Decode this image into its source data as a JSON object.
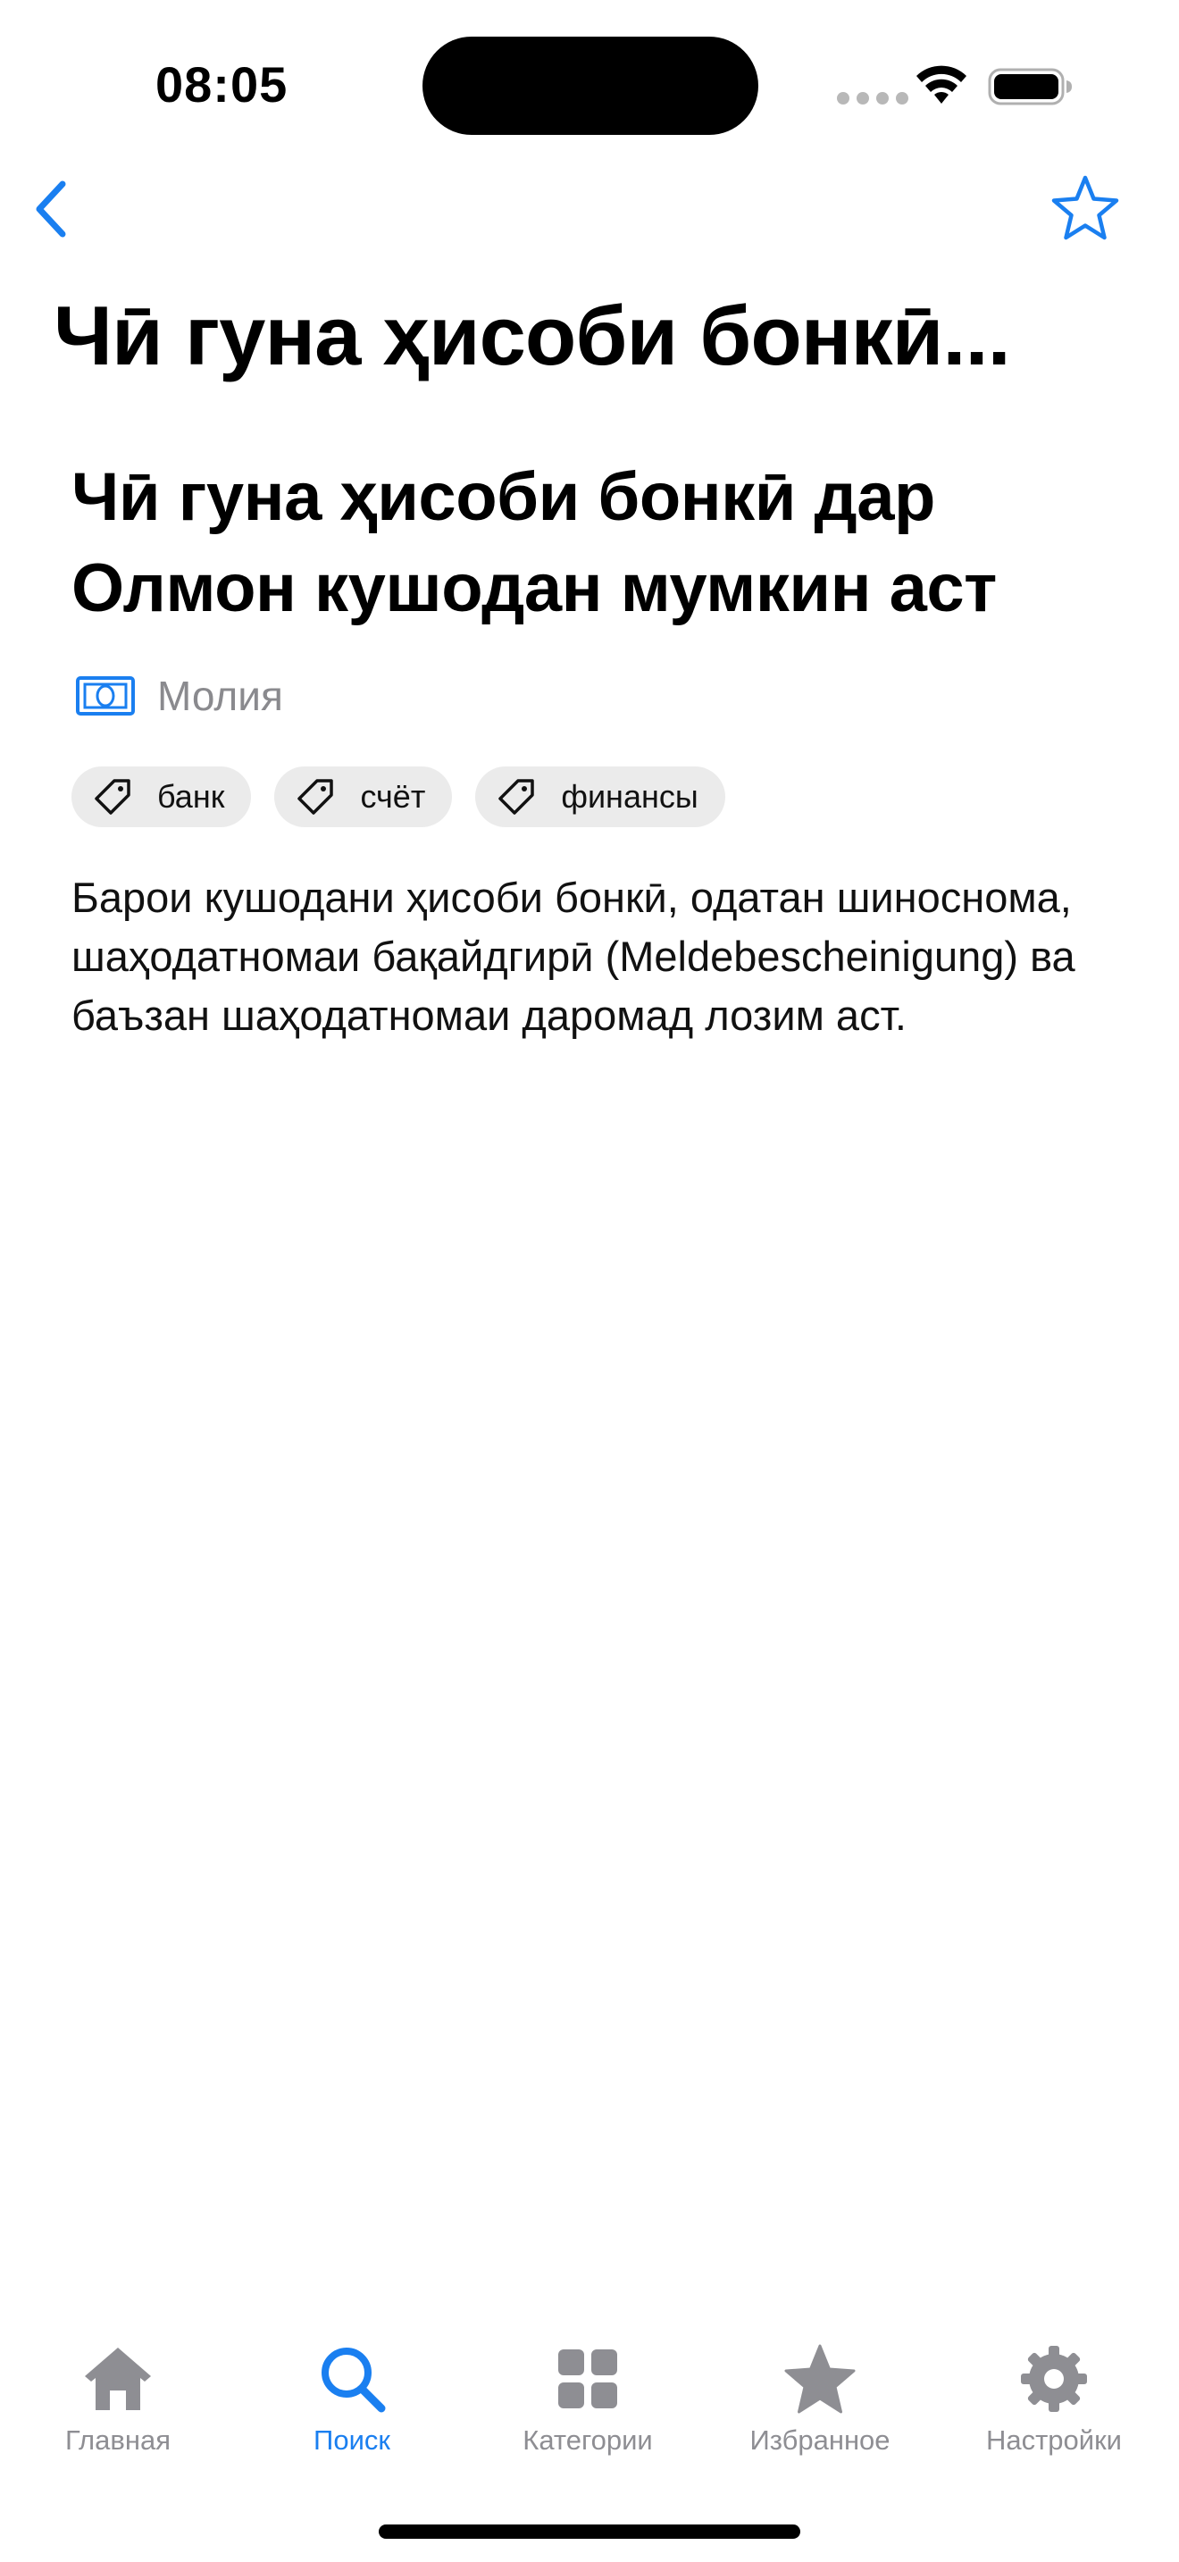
{
  "status_bar": {
    "time": "08:05"
  },
  "navigation": {
    "title": "Чӣ гуна ҳисоби бонкӣ...",
    "back_icon": "chevron-left-icon",
    "favorite_icon": "star-outline-icon"
  },
  "article": {
    "title": "Чӣ гуна ҳисоби бонкӣ дар Олмон кушодан мумкин аст",
    "category": {
      "icon": "banknote-icon",
      "label": "Молия"
    },
    "tags": [
      {
        "label": "банк"
      },
      {
        "label": "счёт"
      },
      {
        "label": "финансы"
      }
    ],
    "body": "Барои кушодани ҳисоби бонкӣ, одатан шиноснома, шаҳодатномаи бақайдгирӣ (Meldebescheinigung) ва баъзан шаҳодатномаи даромад лозим аст."
  },
  "tabbar": {
    "items": [
      {
        "label": "Главная",
        "icon": "house-icon",
        "active": false
      },
      {
        "label": "Поиск",
        "icon": "search-icon",
        "active": true
      },
      {
        "label": "Категории",
        "icon": "grid-icon",
        "active": false
      },
      {
        "label": "Избранное",
        "icon": "star-icon",
        "active": false
      },
      {
        "label": "Настройки",
        "icon": "gear-icon",
        "active": false
      }
    ]
  },
  "colors": {
    "accent": "#1a7ff0",
    "inactive": "#8e8e93",
    "tag_background": "#ebebeb"
  }
}
